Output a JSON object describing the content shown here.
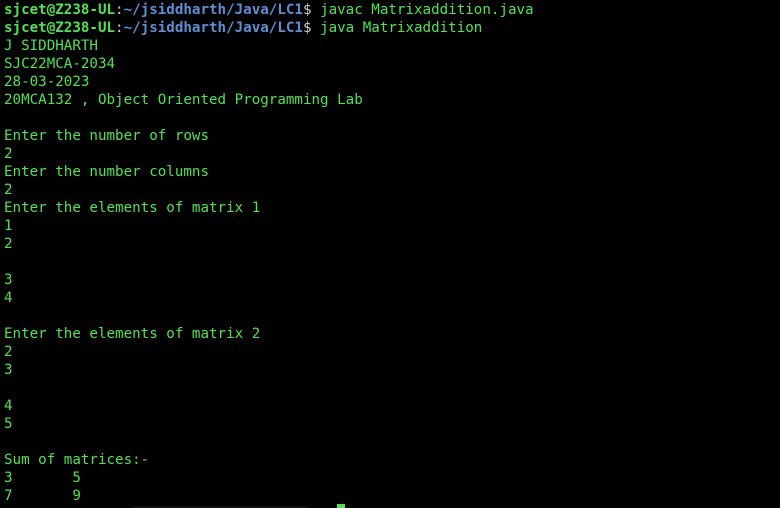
{
  "prompt": {
    "user_host": "sjcet@Z238-UL",
    "colon": ":",
    "path": "~/jsiddharth/Java/LC1",
    "dollar": "$"
  },
  "commands": {
    "compile": "javac Matrixaddition.java",
    "run": "java Matrixaddition"
  },
  "output": [
    "J SIDDHARTH",
    "SJC22MCA-2034",
    "28-03-2023",
    "20MCA132 , Object Oriented Programming Lab",
    "",
    "Enter the number of rows",
    "2",
    "Enter the number columns",
    "2",
    "Enter the elements of matrix 1",
    "1",
    "2",
    "",
    "3",
    "4",
    "",
    "Enter the elements of matrix 2",
    "2",
    "3",
    "",
    "4",
    "5",
    "",
    "Sum of matrices:-",
    "3       5",
    "7       9"
  ],
  "colors": {
    "background": "#000000",
    "text_green": "#4ee44e",
    "path_blue": "#5c8fd6"
  }
}
